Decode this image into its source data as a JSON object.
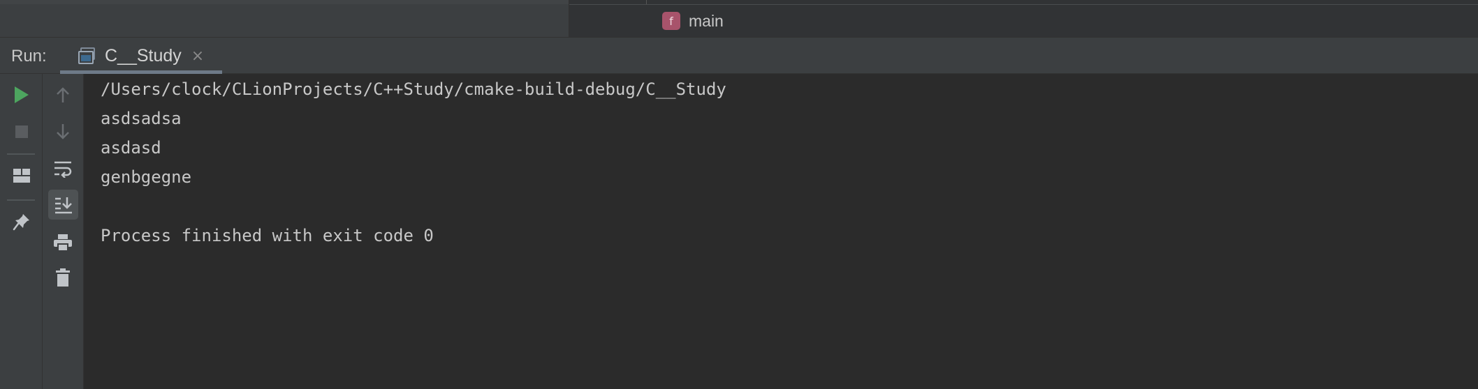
{
  "editor": {
    "breadcrumb": {
      "icon_letter": "f",
      "function_name": "main",
      "icon_color": "#a8536b"
    }
  },
  "run_window": {
    "label": "Run:",
    "tab": {
      "title": "C__Study",
      "close_glyph": "×"
    }
  },
  "toolbar_primary": {
    "buttons": [
      {
        "name": "rerun",
        "icon": "play-icon",
        "color": "#4da55f"
      },
      {
        "name": "stop",
        "icon": "stop-icon",
        "enabled": false
      },
      {
        "name": "restore-layout",
        "icon": "layout-icon"
      },
      {
        "name": "pin-tab",
        "icon": "pin-icon"
      }
    ]
  },
  "toolbar_secondary": {
    "buttons": [
      {
        "name": "up-stack-trace",
        "icon": "arrow-up-icon",
        "enabled": false
      },
      {
        "name": "down-stack-trace",
        "icon": "arrow-down-icon",
        "enabled": false
      },
      {
        "name": "soft-wrap",
        "icon": "soft-wrap-icon"
      },
      {
        "name": "scroll-to-end",
        "icon": "scroll-to-end-icon",
        "active": true
      },
      {
        "name": "print",
        "icon": "print-icon"
      },
      {
        "name": "clear-all",
        "icon": "trash-icon"
      }
    ]
  },
  "console": {
    "lines": [
      "/Users/clock/CLionProjects/C++Study/cmake-build-debug/C__Study",
      "asdsadsa",
      "asdasd",
      "genbgegne",
      "",
      "Process finished with exit code 0"
    ]
  }
}
